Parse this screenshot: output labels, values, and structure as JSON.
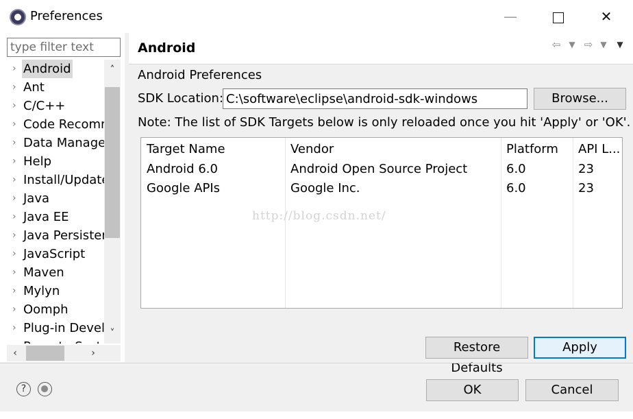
{
  "window": {
    "title": "Preferences",
    "minimize_glyph": "—",
    "close_glyph": "✕"
  },
  "filter": {
    "placeholder": "type filter text"
  },
  "tree": {
    "items": [
      {
        "label": "Android",
        "selected": true
      },
      {
        "label": "Ant"
      },
      {
        "label": "C/C++"
      },
      {
        "label": "Code Recomm"
      },
      {
        "label": "Data Manage"
      },
      {
        "label": "Help"
      },
      {
        "label": "Install/Update"
      },
      {
        "label": "Java"
      },
      {
        "label": "Java EE"
      },
      {
        "label": "Java Persisten"
      },
      {
        "label": "JavaScript"
      },
      {
        "label": "Maven"
      },
      {
        "label": "Mylyn"
      },
      {
        "label": "Oomph"
      },
      {
        "label": "Plug-in Devel"
      },
      {
        "label": "Remote Syst"
      }
    ]
  },
  "page": {
    "title": "Android",
    "section_title": "Android Preferences",
    "sdk_label": "SDK Location:",
    "sdk_value": "C:\\software\\eclipse\\android-sdk-windows",
    "browse_label": "Browse...",
    "note": "Note: The list of SDK Targets below is only reloaded once you hit 'Apply' or 'OK'."
  },
  "targets": {
    "columns": [
      "Target Name",
      "Vendor",
      "Platform",
      "API L..."
    ],
    "rows": [
      [
        "Android 6.0",
        "Android Open Source Project",
        "6.0",
        "23"
      ],
      [
        "Google APIs",
        "Google Inc.",
        "6.0",
        "23"
      ]
    ]
  },
  "watermark": "http://blog.csdn.net/",
  "buttons": {
    "restore_defaults": "Restore Defaults",
    "apply": "Apply",
    "ok": "OK",
    "cancel": "Cancel"
  },
  "icons": {
    "app": "eclipse-icon",
    "help": "help-icon",
    "tip": "tip-icon",
    "back": "back-arrow-icon",
    "forward": "forward-arrow-icon",
    "menu": "view-menu-icon"
  },
  "colors": {
    "accent": "#0078d7",
    "button_face": "#e1e1e1",
    "dialog_bg": "#f0f0f0"
  }
}
